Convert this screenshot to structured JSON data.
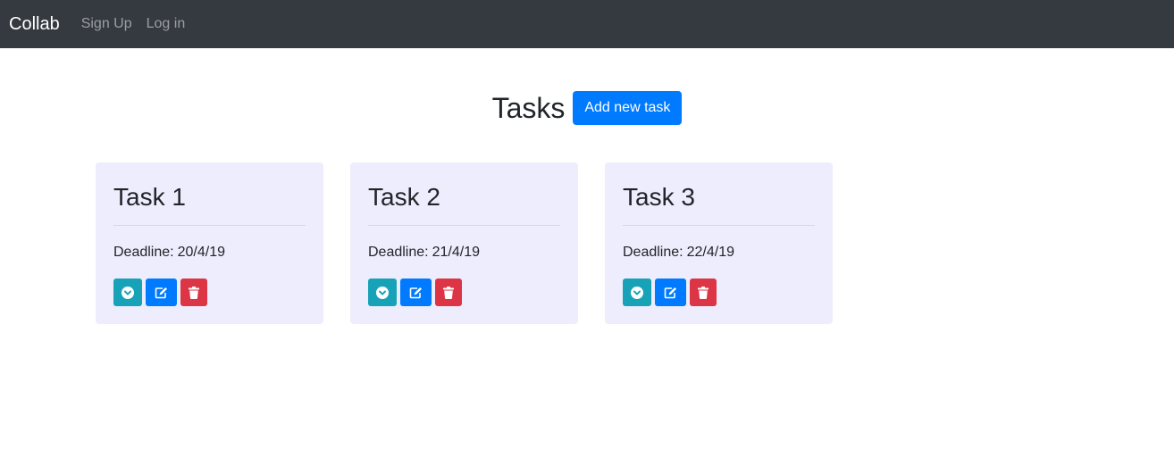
{
  "navbar": {
    "brand": "Collab",
    "links": [
      {
        "label": "Sign Up"
      },
      {
        "label": "Log in"
      }
    ]
  },
  "page": {
    "title": "Tasks",
    "add_button_label": "Add new task"
  },
  "colors": {
    "navbar_bg": "#343a40",
    "primary": "#007bff",
    "info": "#17a2b8",
    "danger": "#dc3545",
    "card_bg": "#eeedfd"
  },
  "deadline_label": "Deadline:",
  "tasks": [
    {
      "title": "Task 1",
      "deadline": "20/4/19"
    },
    {
      "title": "Task 2",
      "deadline": "21/4/19"
    },
    {
      "title": "Task 3",
      "deadline": "22/4/19"
    }
  ],
  "icons": {
    "expand": "chevron-circle-down-icon",
    "edit": "edit-icon",
    "delete": "trash-icon"
  }
}
